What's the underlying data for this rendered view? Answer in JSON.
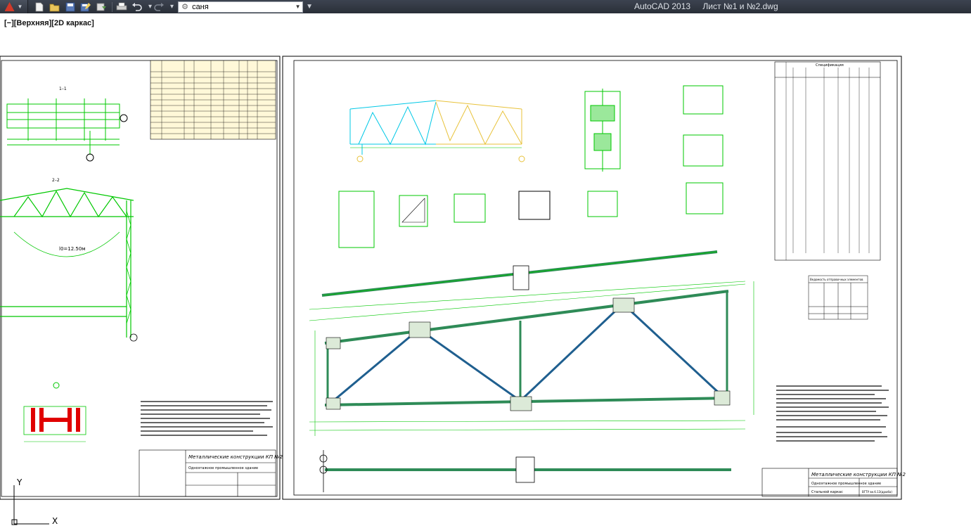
{
  "window": {
    "app_name": "AutoCAD 2013",
    "file_name": "Лист №1 и №2.dwg"
  },
  "quick_access": {
    "workspace_value": "саня",
    "buttons": [
      "new-icon",
      "open-icon",
      "save-icon",
      "save-as-icon",
      "publish-icon",
      "plot-icon",
      "undo-icon",
      "redo-icon"
    ]
  },
  "viewport": {
    "controls_label": "[−][Верхняя][2D каркас]"
  },
  "sheet_left": {
    "title": "Металлические конструкции КП №2",
    "subtitle": "Одноэтажное промышленное здание",
    "section_a": "1–1",
    "section_b": "2–2",
    "span_label": "l0=12.50м",
    "axis_y": "Y",
    "axis_x": "X"
  },
  "sheet_right": {
    "title": "Металлические конструкции КП №2",
    "subtitle": "Одноэтажное промышленное здание",
    "spec_title": "Спецификация",
    "drawing_label": "Стальной каркас",
    "table_title": "Ведомость отправочных элементов",
    "sheet_code": "ВГТУ вк.б.13(дрюба)"
  },
  "colors": {
    "drawing_green": "#00c800",
    "cyan": "#00c8e6",
    "yellow": "#e8c23a",
    "red": "#e00000",
    "frame": "#000000",
    "titlebar": "#2f3540"
  }
}
